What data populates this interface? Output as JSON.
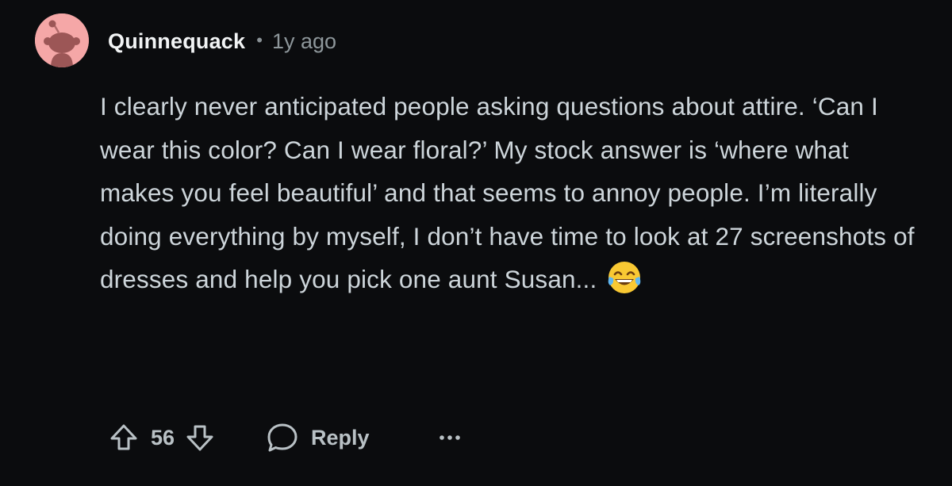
{
  "comment": {
    "username": "Quinnequack",
    "separator": "•",
    "time_ago": "1y ago",
    "body": "I clearly never anticipated people asking questions about attire. ‘Can I wear this color? Can I wear floral?’ My stock answer is ‘where what makes you feel beautiful’ and that seems to annoy people. I’m literally doing everything by myself, I don’t have time to look at 27 screenshots of dresses and help you pick one aunt Susan...",
    "emoji": "face-with-tears-of-joy",
    "avatar_color": "#f5a7a7"
  },
  "actions": {
    "vote_count": "56",
    "reply_label": "Reply",
    "upvote_icon": "arrow-up-icon",
    "downvote_icon": "arrow-down-icon",
    "reply_icon": "speech-bubble-icon",
    "more_icon": "ellipsis-icon"
  }
}
